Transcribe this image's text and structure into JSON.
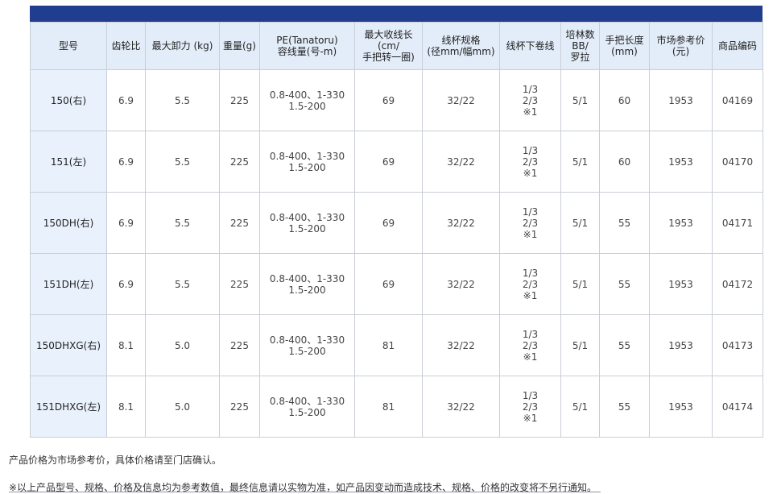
{
  "colors": {
    "accent_bar": "#203d8f",
    "header_bg": "#e3edf9",
    "model_cell_bg": "#e9f2fc"
  },
  "table": {
    "headers": [
      "型号",
      "齿轮比",
      "最大卸力 (kg)",
      "重量(g)",
      "PE(Tanatoru)\n容线量(号-m)",
      "最大收线长\n(cm/\n手把转一圈)",
      "线杯规格\n(径mm/幅mm)",
      "线杯下卷线",
      "培林数\nBB/\n罗拉",
      "手把长度\n(mm)",
      "市场参考价\n(元)",
      "商品编码"
    ],
    "rows": [
      [
        "150(右)",
        "6.9",
        "5.5",
        "225",
        "0.8-400、1-330\n1.5-200",
        "69",
        "32/22",
        "1/3\n2/3\n※1",
        "5/1",
        "60",
        "1953",
        "04169"
      ],
      [
        "151(左)",
        "6.9",
        "5.5",
        "225",
        "0.8-400、1-330\n1.5-200",
        "69",
        "32/22",
        "1/3\n2/3\n※1",
        "5/1",
        "60",
        "1953",
        "04170"
      ],
      [
        "150DH(右)",
        "6.9",
        "5.5",
        "225",
        "0.8-400、1-330\n1.5-200",
        "69",
        "32/22",
        "1/3\n2/3\n※1",
        "5/1",
        "55",
        "1953",
        "04171"
      ],
      [
        "151DH(左)",
        "6.9",
        "5.5",
        "225",
        "0.8-400、1-330\n1.5-200",
        "69",
        "32/22",
        "1/3\n2/3\n※1",
        "5/1",
        "55",
        "1953",
        "04172"
      ],
      [
        "150DHXG(右)",
        "8.1",
        "5.0",
        "225",
        "0.8-400、1-330\n1.5-200",
        "81",
        "32/22",
        "1/3\n2/3\n※1",
        "5/1",
        "55",
        "1953",
        "04173"
      ],
      [
        "151DHXG(左)",
        "8.1",
        "5.0",
        "225",
        "0.8-400、1-330\n1.5-200",
        "81",
        "32/22",
        "1/3\n2/3\n※1",
        "5/1",
        "55",
        "1953",
        "04174"
      ]
    ]
  },
  "notes": {
    "price_note": "产品价格为市场参考价，具体价格请至门店确认。",
    "disclaimer": "※以上产品型号、规格、价格及信息均为参考数值，最终信息请以实物为准，如产品因变动而造成技术、规格、价格的改变将不另行通知。"
  }
}
